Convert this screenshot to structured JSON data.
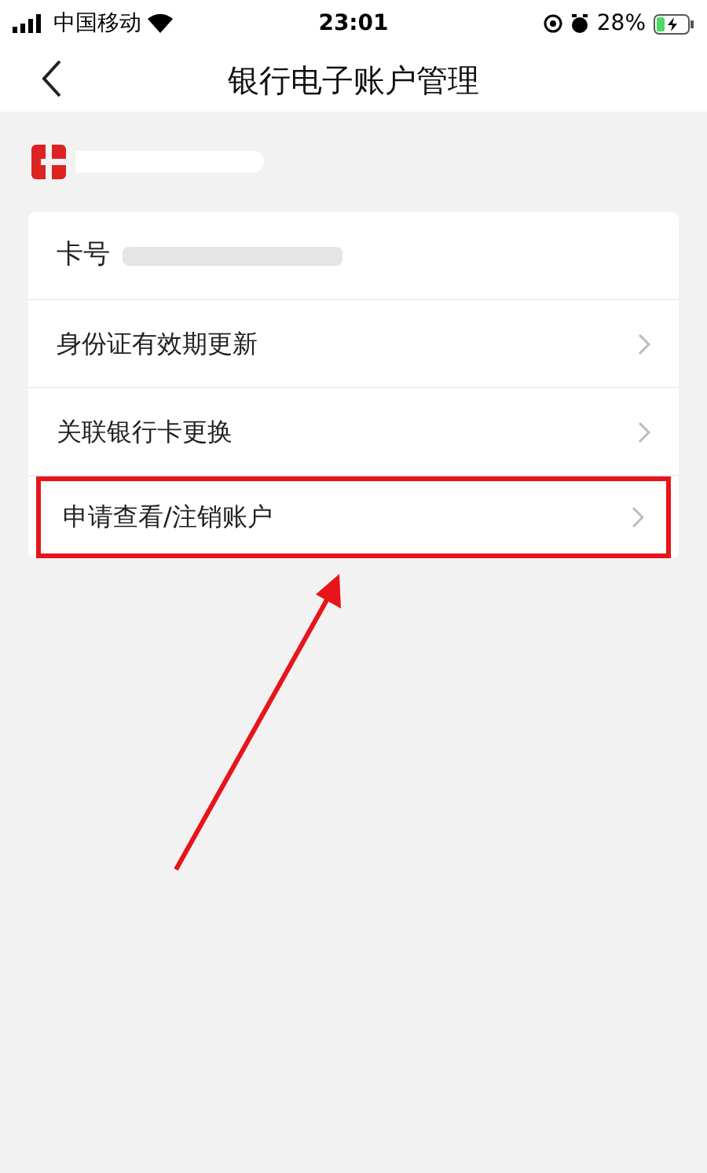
{
  "status_bar": {
    "carrier": "中国移动",
    "time": "23:01",
    "battery": "28%"
  },
  "nav": {
    "title": "银行电子账户管理"
  },
  "card": {
    "label": "卡号"
  },
  "menu": [
    {
      "label": "身份证有效期更新",
      "highlighted": false
    },
    {
      "label": "关联银行卡更换",
      "highlighted": false
    },
    {
      "label": "申请查看/注销账户",
      "highlighted": true
    }
  ]
}
